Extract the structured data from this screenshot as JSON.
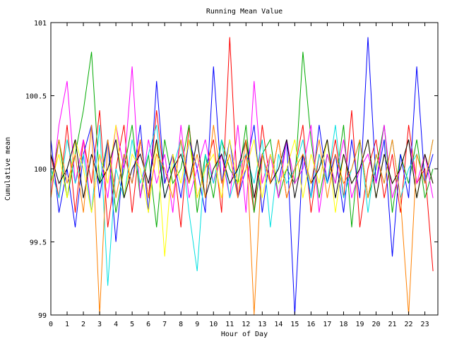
{
  "chart_data": {
    "type": "line",
    "title": "Running Mean Value",
    "xlabel": "Hour of Day",
    "ylabel": "Cumulative mean",
    "xlim": [
      0,
      23.8
    ],
    "ylim": [
      99,
      101
    ],
    "x_ticks": [
      0,
      1,
      2,
      3,
      4,
      5,
      6,
      7,
      8,
      9,
      10,
      11,
      12,
      13,
      14,
      15,
      16,
      17,
      18,
      19,
      20,
      21,
      22,
      23
    ],
    "x_tick_labels": [
      "0",
      "1",
      "2",
      "3",
      "4",
      "5",
      "6",
      "7",
      "8",
      "9",
      "10",
      "11",
      "12",
      "13",
      "14",
      "15",
      "16",
      "17",
      "18",
      "19",
      "20",
      "21",
      "22",
      "23"
    ],
    "y_ticks": [
      99,
      99.5,
      100,
      100.5,
      101
    ],
    "y_tick_labels": [
      "99",
      "99.5",
      "100",
      "100.5",
      "101"
    ],
    "grid": false,
    "legend": "none",
    "series_colors": [
      "#ff0000",
      "#00aa00",
      "#0000ff",
      "#ff00ff",
      "#00e0e0",
      "#ffff00",
      "#000000",
      "#ff8000"
    ],
    "series": [
      {
        "x": [
          0,
          0.5,
          1,
          1.5,
          2,
          2.5,
          3,
          3.5,
          4,
          4.5,
          5,
          5.5,
          6,
          6.5,
          7,
          7.5,
          8,
          8.5,
          9,
          9.5,
          10,
          10.5,
          11,
          11.5,
          12,
          12.5,
          13,
          13.5,
          14,
          14.5,
          15,
          15.5,
          16,
          16.5,
          17,
          17.5,
          18,
          18.5,
          19,
          19.5,
          20,
          20.5,
          21,
          21.5,
          22,
          22.5,
          23,
          23.5
        ],
        "values": [
          100.1,
          99.8,
          100.3,
          99.7,
          100.2,
          99.9,
          100.4,
          99.6,
          100.0,
          100.3,
          99.7,
          100.2,
          99.8,
          100.4,
          99.9,
          100.1,
          99.6,
          100.3,
          99.8,
          100.0,
          100.2,
          99.7,
          100.9,
          99.8,
          100.1,
          99.7,
          100.3,
          99.9,
          100.2,
          99.8,
          100.0,
          100.3,
          99.7,
          100.1,
          99.9,
          100.2,
          99.8,
          100.4,
          99.6,
          100.0,
          100.2,
          99.8,
          100.1,
          99.7,
          100.3,
          99.9,
          100.0,
          99.3
        ]
      },
      {
        "x": [
          0,
          0.5,
          1,
          1.5,
          2,
          2.5,
          3,
          3.5,
          4,
          4.5,
          5,
          5.5,
          6,
          6.5,
          7,
          7.5,
          8,
          8.5,
          9,
          9.5,
          10,
          10.5,
          11,
          11.5,
          12,
          12.5,
          13,
          13.5,
          14,
          14.5,
          15,
          15.5,
          16,
          16.5,
          17,
          17.5,
          18,
          18.5,
          19,
          19.5,
          20,
          20.5,
          21,
          21.5,
          22,
          22.5,
          23,
          23.5
        ],
        "values": [
          99.9,
          100.2,
          99.8,
          100.1,
          100.4,
          100.8,
          99.9,
          100.2,
          99.7,
          100.0,
          100.3,
          99.8,
          100.1,
          99.6,
          100.2,
          99.9,
          100.0,
          100.3,
          99.7,
          100.1,
          99.8,
          100.2,
          100.0,
          99.9,
          100.3,
          99.7,
          100.1,
          100.2,
          99.8,
          100.0,
          99.9,
          100.8,
          100.2,
          99.8,
          100.1,
          99.9,
          100.3,
          99.6,
          100.2,
          99.8,
          100.0,
          100.3,
          99.7,
          100.1,
          99.9,
          100.2,
          99.8,
          100.0
        ]
      },
      {
        "x": [
          0,
          0.5,
          1,
          1.5,
          2,
          2.5,
          3,
          3.5,
          4,
          4.5,
          5,
          5.5,
          6,
          6.5,
          7,
          7.5,
          8,
          8.5,
          9,
          9.5,
          10,
          10.5,
          11,
          11.5,
          12,
          12.5,
          13,
          13.5,
          14,
          14.5,
          15,
          15.5,
          16,
          16.5,
          17,
          17.5,
          18,
          18.5,
          19,
          19.5,
          20,
          20.5,
          21,
          21.5,
          22,
          22.5,
          23,
          23.5
        ],
        "values": [
          100.2,
          99.7,
          100.0,
          99.6,
          100.1,
          100.3,
          99.8,
          100.2,
          99.5,
          100.1,
          99.9,
          100.3,
          99.7,
          100.6,
          99.9,
          100.1,
          99.8,
          100.2,
          100.0,
          99.7,
          100.7,
          99.9,
          100.2,
          99.8,
          100.0,
          100.3,
          99.7,
          100.1,
          99.9,
          100.2,
          99.0,
          100.1,
          99.8,
          100.3,
          99.9,
          100.1,
          99.7,
          100.2,
          99.8,
          100.9,
          99.9,
          100.2,
          99.4,
          100.1,
          99.8,
          100.7,
          99.9,
          100.1
        ]
      },
      {
        "x": [
          0,
          0.5,
          1,
          1.5,
          2,
          2.5,
          3,
          3.5,
          4,
          4.5,
          5,
          5.5,
          6,
          6.5,
          7,
          7.5,
          8,
          8.5,
          9,
          9.5,
          10,
          10.5,
          11,
          11.5,
          12,
          12.5,
          13,
          13.5,
          14,
          14.5,
          15,
          15.5,
          16,
          16.5,
          17,
          17.5,
          18,
          18.5,
          19,
          19.5,
          20,
          20.5,
          21,
          21.5,
          22,
          22.5,
          23,
          23.5
        ],
        "values": [
          99.8,
          100.3,
          100.6,
          99.9,
          100.2,
          99.7,
          100.1,
          99.8,
          100.3,
          100.0,
          100.7,
          99.8,
          100.2,
          99.9,
          100.1,
          99.7,
          100.3,
          99.8,
          100.0,
          100.2,
          99.9,
          100.1,
          99.8,
          100.3,
          99.7,
          100.6,
          99.9,
          100.1,
          99.8,
          100.2,
          99.9,
          100.0,
          100.3,
          99.7,
          100.1,
          99.9,
          100.2,
          99.8,
          100.0,
          100.1,
          99.9,
          100.3,
          99.8,
          100.0,
          100.2,
          99.9,
          100.1,
          99.8
        ]
      },
      {
        "x": [
          0,
          0.5,
          1,
          1.5,
          2,
          2.5,
          3,
          3.5,
          4,
          4.5,
          5,
          5.5,
          6,
          6.5,
          7,
          7.5,
          8,
          8.5,
          9,
          9.5,
          10,
          10.5,
          11,
          11.5,
          12,
          12.5,
          13,
          13.5,
          14,
          14.5,
          15,
          15.5,
          16,
          16.5,
          17,
          17.5,
          18,
          18.5,
          19,
          19.5,
          20,
          20.5,
          21,
          21.5,
          22,
          22.5,
          23,
          23.5
        ],
        "values": [
          100.0,
          99.8,
          100.2,
          99.9,
          100.1,
          99.7,
          100.3,
          99.2,
          100.0,
          99.8,
          100.2,
          99.9,
          100.1,
          100.3,
          99.8,
          100.0,
          100.2,
          99.7,
          99.3,
          100.1,
          99.9,
          100.2,
          99.8,
          100.0,
          100.1,
          99.9,
          100.2,
          99.6,
          100.1,
          99.9,
          100.0,
          100.2,
          99.8,
          100.1,
          99.9,
          100.3,
          99.8,
          100.0,
          100.2,
          99.7,
          100.1,
          99.9,
          100.2,
          99.8,
          100.0,
          100.1,
          99.9,
          100.2
        ]
      },
      {
        "x": [
          0,
          0.5,
          1,
          1.5,
          2,
          2.5,
          3,
          3.5,
          4,
          4.5,
          5,
          5.5,
          6,
          6.5,
          7,
          7.5,
          8,
          8.5,
          9,
          9.5,
          10,
          10.5,
          11,
          11.5,
          12,
          12.5,
          13,
          13.5,
          14,
          14.5,
          15,
          15.5,
          16,
          16.5,
          17,
          17.5,
          18,
          18.5,
          19,
          19.5,
          20,
          20.5,
          21,
          21.5,
          22,
          22.5,
          23,
          23.5
        ],
        "values": [
          99.9,
          100.1,
          99.8,
          100.2,
          100.0,
          99.7,
          100.1,
          99.9,
          100.3,
          99.8,
          100.1,
          100.0,
          99.7,
          100.2,
          99.4,
          100.1,
          99.9,
          100.2,
          99.8,
          100.0,
          100.1,
          99.8,
          100.2,
          99.9,
          100.0,
          100.2,
          99.8,
          100.1,
          99.9,
          100.0,
          100.2,
          99.8,
          100.1,
          99.9,
          100.2,
          99.7,
          100.1,
          99.9,
          100.0,
          100.2,
          99.8,
          100.1,
          99.9,
          100.0,
          100.2,
          99.8,
          100.1,
          99.9
        ]
      },
      {
        "x": [
          0,
          0.5,
          1,
          1.5,
          2,
          2.5,
          3,
          3.5,
          4,
          4.5,
          5,
          5.5,
          6,
          6.5,
          7,
          7.5,
          8,
          8.5,
          9,
          9.5,
          10,
          10.5,
          11,
          11.5,
          12,
          12.5,
          13,
          13.5,
          14,
          14.5,
          15,
          15.5,
          16,
          16.5,
          17,
          17.5,
          18,
          18.5,
          19,
          19.5,
          20,
          20.5,
          21,
          21.5,
          22,
          22.5,
          23,
          23.5
        ],
        "values": [
          100.1,
          99.9,
          100.0,
          100.2,
          99.8,
          100.1,
          99.9,
          100.0,
          100.2,
          99.8,
          100.0,
          100.1,
          99.9,
          100.2,
          99.8,
          100.0,
          100.1,
          99.9,
          100.2,
          99.8,
          100.0,
          100.1,
          99.9,
          100.0,
          100.2,
          99.8,
          100.1,
          99.9,
          100.0,
          100.2,
          99.8,
          100.1,
          99.9,
          100.0,
          100.2,
          99.8,
          100.1,
          99.9,
          100.0,
          100.2,
          99.8,
          100.1,
          99.9,
          100.0,
          100.2,
          99.8,
          100.1,
          99.9
        ]
      },
      {
        "x": [
          0,
          0.5,
          1,
          1.5,
          2,
          2.5,
          3,
          3.5,
          4,
          4.5,
          5,
          5.5,
          6,
          6.5,
          7,
          7.5,
          8,
          8.5,
          9,
          9.5,
          10,
          10.5,
          11,
          11.5,
          12,
          12.5,
          13,
          13.5,
          14,
          14.5,
          15,
          15.5,
          16,
          16.5,
          17,
          17.5,
          18,
          18.5,
          19,
          19.5,
          20,
          20.5,
          21,
          21.5,
          22,
          22.5,
          23,
          23.5
        ],
        "values": [
          99.8,
          100.2,
          99.9,
          100.1,
          99.7,
          100.3,
          99.0,
          100.2,
          99.8,
          100.1,
          99.9,
          100.2,
          99.8,
          100.1,
          100.0,
          99.8,
          100.2,
          99.9,
          100.1,
          99.8,
          100.3,
          99.9,
          100.1,
          99.8,
          100.2,
          99.0,
          100.1,
          99.9,
          100.2,
          99.8,
          100.0,
          100.1,
          99.9,
          100.2,
          99.8,
          100.1,
          99.9,
          100.0,
          100.2,
          99.8,
          100.1,
          99.9,
          100.2,
          99.8,
          99.0,
          100.1,
          99.9,
          100.2
        ]
      }
    ]
  }
}
